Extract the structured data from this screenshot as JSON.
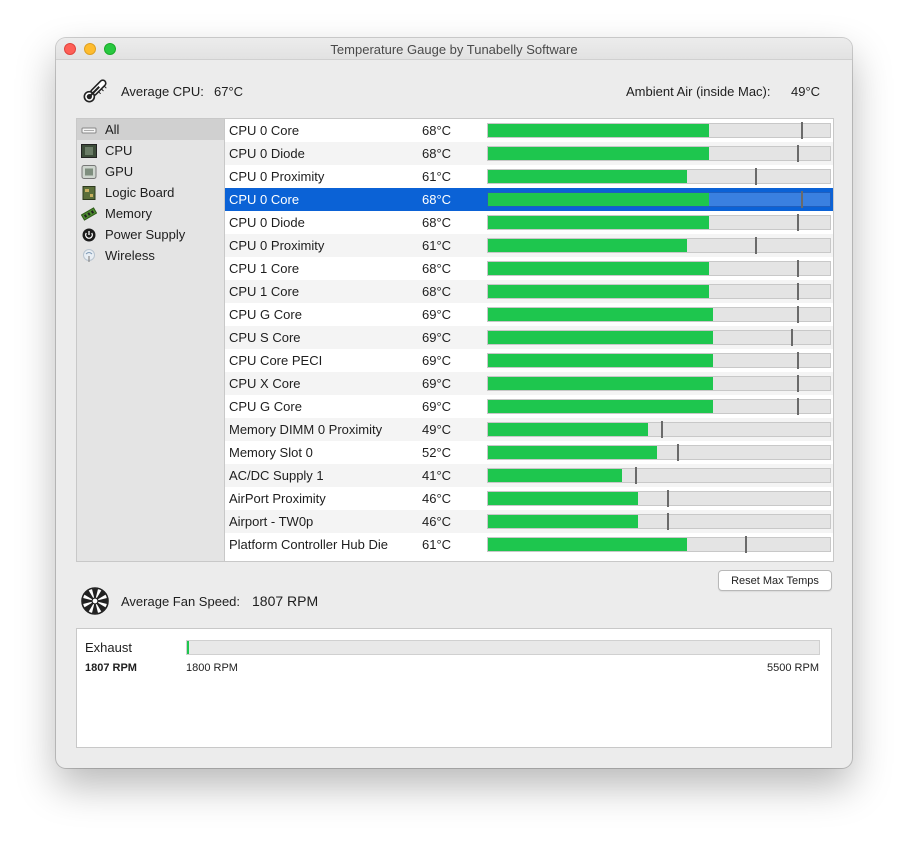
{
  "window": {
    "title": "Temperature Gauge by Tunabelly Software"
  },
  "summary": {
    "avg_cpu_label": "Average CPU:",
    "avg_cpu_value": "67°C",
    "ambient_label": "Ambient Air (inside Mac):",
    "ambient_value": "49°C"
  },
  "sidebar": {
    "items": [
      {
        "label": "All",
        "icon": "all-icon",
        "selected": true
      },
      {
        "label": "CPU",
        "icon": "cpu-chip-icon"
      },
      {
        "label": "GPU",
        "icon": "gpu-chip-icon"
      },
      {
        "label": "Logic Board",
        "icon": "logic-board-icon"
      },
      {
        "label": "Memory",
        "icon": "memory-stick-icon"
      },
      {
        "label": "Power Supply",
        "icon": "power-icon"
      },
      {
        "label": "Wireless",
        "icon": "wireless-icon"
      }
    ]
  },
  "sensors": {
    "scale_max_c": 105,
    "rows": [
      {
        "name": "CPU 0 Core",
        "temp": "68°C",
        "value": 68,
        "max": 96
      },
      {
        "name": "CPU 0 Diode",
        "temp": "68°C",
        "value": 68,
        "max": 95
      },
      {
        "name": "CPU 0 Proximity",
        "temp": "61°C",
        "value": 61,
        "max": 82
      },
      {
        "name": "CPU 0 Core",
        "temp": "68°C",
        "value": 68,
        "max": 96,
        "selected": true
      },
      {
        "name": "CPU 0 Diode",
        "temp": "68°C",
        "value": 68,
        "max": 95
      },
      {
        "name": "CPU 0 Proximity",
        "temp": "61°C",
        "value": 61,
        "max": 82
      },
      {
        "name": "CPU 1 Core",
        "temp": "68°C",
        "value": 68,
        "max": 95
      },
      {
        "name": "CPU 1 Core",
        "temp": "68°C",
        "value": 68,
        "max": 95
      },
      {
        "name": "CPU G Core",
        "temp": "69°C",
        "value": 69,
        "max": 95
      },
      {
        "name": "CPU S Core",
        "temp": "69°C",
        "value": 69,
        "max": 93
      },
      {
        "name": "CPU Core PECI",
        "temp": "69°C",
        "value": 69,
        "max": 95
      },
      {
        "name": "CPU X Core",
        "temp": "69°C",
        "value": 69,
        "max": 95
      },
      {
        "name": "CPU G Core",
        "temp": "69°C",
        "value": 69,
        "max": 95
      },
      {
        "name": "Memory DIMM 0 Proximity",
        "temp": "49°C",
        "value": 49,
        "max": 53
      },
      {
        "name": "Memory Slot 0",
        "temp": "52°C",
        "value": 52,
        "max": 58
      },
      {
        "name": "AC/DC Supply 1",
        "temp": "41°C",
        "value": 41,
        "max": 45
      },
      {
        "name": "AirPort Proximity",
        "temp": "46°C",
        "value": 46,
        "max": 55
      },
      {
        "name": "Airport - TW0p",
        "temp": "46°C",
        "value": 46,
        "max": 55
      },
      {
        "name": "Platform Controller Hub Die",
        "temp": "61°C",
        "value": 61,
        "max": 79
      }
    ]
  },
  "actions": {
    "reset_label": "Reset Max Temps"
  },
  "fans": {
    "avg_label": "Average Fan Speed:",
    "avg_value": "1807 RPM",
    "items": [
      {
        "name": "Exhaust",
        "rpm": "1807 RPM",
        "rpm_value": 1807,
        "min_label": "1800 RPM",
        "min_value": 1800,
        "max_label": "5500 RPM",
        "max_value": 5500
      }
    ]
  },
  "colors": {
    "fill": "#1ec64e",
    "selection": "#0b62d6",
    "max_marker": "#6a6a6a"
  }
}
